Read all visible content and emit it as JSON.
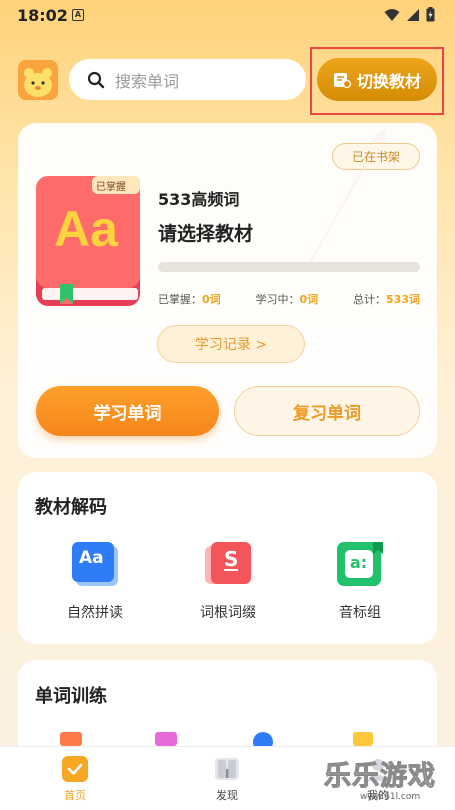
{
  "status_bar": {
    "time": "18:02",
    "app_icon_letter": "A"
  },
  "header": {
    "search_placeholder": "搜索单词",
    "switch_button_label": "切换教材"
  },
  "main_card": {
    "shelf_badge": "已在书架",
    "book": {
      "cover_tag": "已掌握",
      "cover_text": "Aa",
      "title": "533高频词",
      "subtitle": "请选择教材"
    },
    "progress": 0,
    "stats": [
      {
        "label": "已掌握：",
        "value": "0词"
      },
      {
        "label": "学习中：",
        "value": "0词"
      },
      {
        "label": "总计：",
        "value": "533词"
      }
    ],
    "record_button": "学习记录 >",
    "learn_button": "学习单词",
    "review_button": "复习单词"
  },
  "decode_section": {
    "title": "教材解码",
    "items": [
      {
        "label": "自然拼读",
        "icon": "aa-card-icon",
        "glyph": "Aa",
        "color": "#2e7df6"
      },
      {
        "label": "词根词缀",
        "icon": "s-card-icon",
        "glyph": "S",
        "color": "#f2555a"
      },
      {
        "label": "音标组",
        "icon": "phonetic-card-icon",
        "glyph": "a:",
        "color": "#21c26a"
      }
    ]
  },
  "training_section": {
    "title": "单词训练"
  },
  "bottom_nav": {
    "items": [
      {
        "label": "首页",
        "icon": "home-check-icon",
        "active": true
      },
      {
        "label": "发现",
        "icon": "book-icon",
        "active": false
      },
      {
        "label": "我的",
        "icon": "profile-icon",
        "active": false
      }
    ]
  },
  "watermark": {
    "text": "乐乐游戏",
    "url": "www.61l.com"
  },
  "colors": {
    "accent": "#f5a623",
    "switch_button": "#d99207",
    "highlight_border": "#ee4444"
  }
}
